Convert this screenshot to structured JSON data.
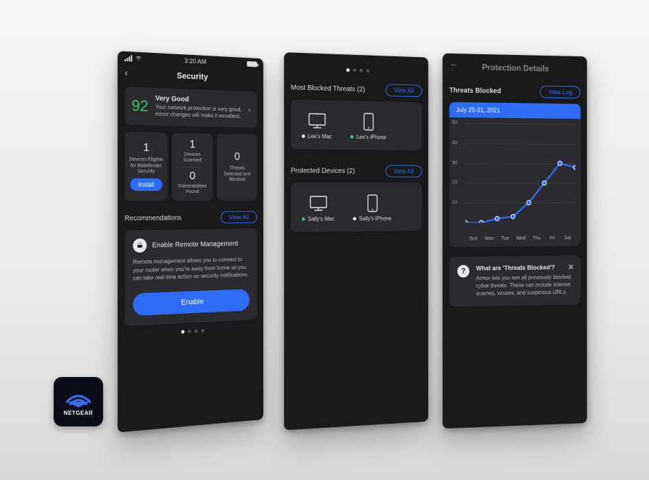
{
  "brand": {
    "name": "NETGEAR"
  },
  "statusbar": {
    "time": "3:20 AM"
  },
  "phone1": {
    "title": "Security",
    "score": {
      "value": "92",
      "heading": "Very Good",
      "sub": "Your network protection is very good, minor changes will make it excellent."
    },
    "stats": {
      "eligible_n": "1",
      "eligible_l": "Devices Eligible for Bitdefender Security",
      "install_btn": "Install",
      "scanned_n": "1",
      "scanned_l": "Devices Scanned",
      "vuln_n": "0",
      "vuln_l": "Vulnerabilities Found",
      "threats_n": "0",
      "threats_l": "Threats Detected and Blocked"
    },
    "recommendations_label": "Recommendations",
    "view_all": "View All",
    "reco": {
      "title": "Enable Remote Management",
      "body": "Remote management allows you to connect to your router when you're away from home so you can take real-time action on security notifications.",
      "enable_btn": "Enable"
    }
  },
  "phone2": {
    "blocked_label": "Most Blocked Threats (2)",
    "protected_label": "Protected Devices (2)",
    "view_all": "View All",
    "blocked_devices": [
      {
        "name": "Lee's Mac",
        "status": "white",
        "type": "desktop"
      },
      {
        "name": "Lee's iPhone",
        "status": "green",
        "type": "phone"
      }
    ],
    "protected_devices": [
      {
        "name": "Sally's Mac",
        "status": "green",
        "type": "desktop"
      },
      {
        "name": "Sally's iPhone",
        "status": "white",
        "type": "phone"
      }
    ]
  },
  "phone3": {
    "nav_title": "Protection Details",
    "section_label": "Threats Blocked",
    "view_log": "View Log",
    "date_range": "July 25-31, 2021",
    "tip": {
      "heading": "What are 'Threats Blocked'?",
      "body": "Armor lets you see all previously blocked cyber threats. These can include internet scames, viruses, and suspicious URLs."
    }
  },
  "chart_data": {
    "type": "line",
    "title": "Threats Blocked",
    "xlabel": "",
    "ylabel": "",
    "ylim": [
      0,
      50
    ],
    "yticks": [
      10,
      20,
      30,
      40,
      50
    ],
    "categories": [
      "Sun",
      "Mon",
      "Tue",
      "Wed",
      "Thu",
      "Fri",
      "Sat"
    ],
    "values": [
      0,
      0,
      2,
      3,
      10,
      20,
      30,
      28
    ]
  }
}
